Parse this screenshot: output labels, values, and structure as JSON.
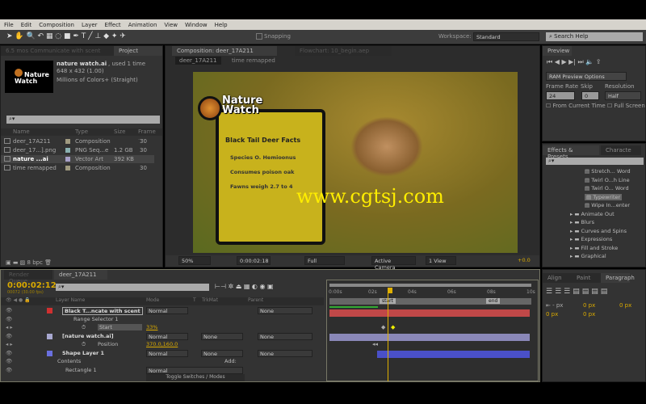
{
  "menu": [
    "File",
    "Edit",
    "Composition",
    "Layer",
    "Effect",
    "Animation",
    "View",
    "Window",
    "Help"
  ],
  "toolbar": {
    "snapping": "Snapping",
    "workspace_label": "Workspace:",
    "workspace": "Standard",
    "search_placeholder": "Search Help"
  },
  "project": {
    "side_tab": "6.5 mos Communicate with scent",
    "tab": "Project",
    "selected_name": "nature watch.ai",
    "used": ", used 1 time",
    "dims": "648 x 432 (1.00)",
    "colors": "Millions of Colors+ (Straight)",
    "thumb_logo": "Nature Watch",
    "columns": [
      "Name",
      "Type",
      "Size",
      "Frame ..."
    ],
    "items": [
      {
        "name": "deer_17A211",
        "type": "Composition",
        "size": "",
        "frame": "30",
        "color": "#a09a80"
      },
      {
        "name": "deer_17...].png",
        "type": "PNG Seq...e",
        "size": "1.2 GB",
        "frame": "30",
        "color": "#8ab0b0"
      },
      {
        "name": "nature ...ai",
        "type": "Vector Art",
        "size": "392 KB",
        "frame": "",
        "color": "#a8a0c8"
      },
      {
        "name": "time remapped",
        "type": "Composition",
        "size": "",
        "frame": "30",
        "color": "#a09a80"
      }
    ],
    "bpc": "8 bpc"
  },
  "comp": {
    "tab": "Composition: deer_17A211",
    "flowchart_tab": "Flowchart: 10_begin.aep",
    "breadcrumb": [
      "deer_17A211",
      "time remapped"
    ],
    "card": {
      "logo": "Nature Watch",
      "title": "Black Tail Deer Facts",
      "lines": [
        "Species O. Hemioonus",
        "Consumes poison oak",
        "Fawns weigh 2.7 to 4"
      ]
    },
    "watermark": "www.cgtsj.com",
    "footer": {
      "zoom": "50%",
      "timecode": "0:00:02:18",
      "resolution": "Full",
      "camera": "Active Camera",
      "view": "1 View",
      "exposure": "+0.0"
    }
  },
  "preview": {
    "tab": "Preview",
    "ram": "RAM Preview Options",
    "frame_rate_label": "Frame Rate",
    "frame_rate": "24",
    "skip_label": "Skip",
    "skip": "0",
    "resolution_label": "Resolution",
    "resolution": "Half",
    "from_current": "From Current Time",
    "full_screen": "Full Screen"
  },
  "effects": {
    "tab": "Effects & Presets",
    "tab2": "Characte",
    "items": [
      {
        "label": "Stretch... Word",
        "kind": "preset"
      },
      {
        "label": "Twirl O...h Line",
        "kind": "preset"
      },
      {
        "label": "Twirl O... Word",
        "kind": "preset"
      },
      {
        "label": "Typewriter",
        "kind": "preset",
        "selected": true
      },
      {
        "label": "Wipe In...enter",
        "kind": "preset"
      },
      {
        "label": "Animate Out",
        "kind": "folder"
      },
      {
        "label": "Blurs",
        "kind": "folder"
      },
      {
        "label": "Curves and Spins",
        "kind": "folder"
      },
      {
        "label": "Expressions",
        "kind": "folder"
      },
      {
        "label": "Fill and Stroke",
        "kind": "folder"
      },
      {
        "label": "Graphical",
        "kind": "folder"
      }
    ]
  },
  "paragraph": {
    "tabs": [
      "Align",
      "Paint",
      "Paragraph"
    ],
    "values": [
      "- px",
      "0 px",
      "0 px",
      "0 px",
      "0 px"
    ]
  },
  "timeline": {
    "tabs": [
      "Render Queue",
      "deer_17A211"
    ],
    "timecode": "0:00:02:12",
    "fps": "00072 (30.00 fps)",
    "headers": [
      "Layer Name",
      "Mode",
      "T",
      "TrkMat",
      "Parent"
    ],
    "ruler": [
      "0:00s",
      "02s",
      "04s",
      "06s",
      "08s",
      "10s"
    ],
    "markers": [
      "start",
      "end"
    ],
    "layers": [
      {
        "name": "Black T...ncate with scent",
        "mode": "Normal",
        "trkmat": "",
        "parent": "None",
        "color": "#d03030",
        "bar": "#c04848"
      },
      {
        "sub": "Range Selector 1"
      },
      {
        "prop": "Start",
        "value": "33%"
      },
      {
        "name": "[nature watch.ai]",
        "mode": "Normal",
        "trkmat": "None",
        "parent": "None",
        "color": "#a8a8d0",
        "bar": "#8a88b8"
      },
      {
        "prop": "Position",
        "value": "370.0,160.0"
      },
      {
        "name": "Shape Layer 1",
        "mode": "Normal",
        "trkmat": "None",
        "parent": "None",
        "color": "#6a70e0",
        "bar": "#4a50c8"
      },
      {
        "sub": "Contents",
        "add": "Add:"
      },
      {
        "sub": "Rectangle 1",
        "mode": "Normal"
      }
    ],
    "toggle": "Toggle Switches / Modes"
  }
}
